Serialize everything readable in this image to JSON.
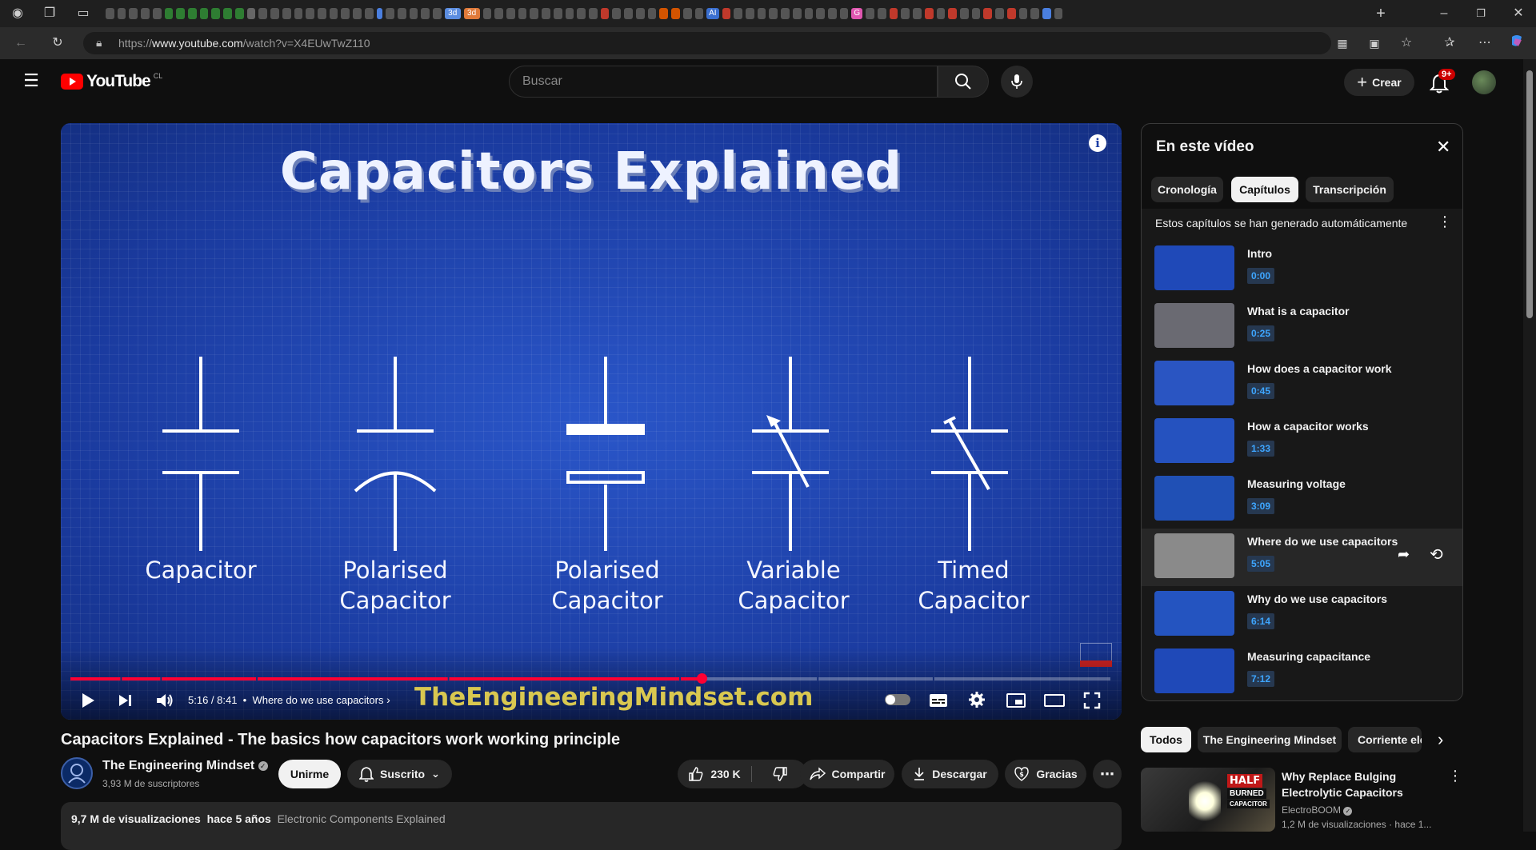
{
  "browser": {
    "url_prefix": "https://",
    "url_host": "www.youtube.com",
    "url_path": "/watch?v=X4EUwTwZ110",
    "tab_badges": [
      "3d",
      "3d",
      "AI",
      "G"
    ]
  },
  "header": {
    "logo_text": "YouTube",
    "country": "CL",
    "search_placeholder": "Buscar",
    "create_label": "Crear",
    "notif_count": "9+"
  },
  "video": {
    "frame_title": "Capacitors Explained",
    "symbols": [
      {
        "line1": "Capacitor",
        "line2": ""
      },
      {
        "line1": "Polarised",
        "line2": "Capacitor"
      },
      {
        "line1": "Polarised",
        "line2": "Capacitor"
      },
      {
        "line1": "Variable",
        "line2": "Capacitor"
      },
      {
        "line1": "Timed",
        "line2": "Capacitor"
      }
    ],
    "watermark": "TheEngineeringMindset.com",
    "time": "5:16 / 8:41",
    "chapter": "Where do we use capacitors",
    "progress": 0.607
  },
  "panel": {
    "title": "En este vídeo",
    "tabs": [
      "Cronología",
      "Capítulos",
      "Transcripción"
    ],
    "active_tab": "Capítulos",
    "note": "Estos capítulos se han generado automáticamente",
    "chapters": [
      {
        "title": "Intro",
        "time": "0:00"
      },
      {
        "title": "What is a capacitor",
        "time": "0:25"
      },
      {
        "title": "How does a capacitor work",
        "time": "0:45"
      },
      {
        "title": "How a capacitor works",
        "time": "1:33"
      },
      {
        "title": "Measuring voltage",
        "time": "3:09"
      },
      {
        "title": "Where do we use capacitors",
        "time": "5:05"
      },
      {
        "title": "Why do we use capacitors",
        "time": "6:14"
      },
      {
        "title": "Measuring capacitance",
        "time": "7:12"
      }
    ]
  },
  "info": {
    "title": "Capacitors Explained - The basics how capacitors work working principle",
    "channel": "The Engineering Mindset",
    "subscribers": "3,93 M de suscriptores",
    "join_label": "Unirme",
    "subscribed_label": "Suscrito",
    "likes": "230 K",
    "share_label": "Compartir",
    "download_label": "Descargar",
    "thanks_label": "Gracias",
    "views": "9,7 M de visualizaciones",
    "age": "hace 5 años",
    "playlist": "Electronic Components Explained"
  },
  "recommendations": {
    "chips": [
      "Todos",
      "The Engineering Mindset",
      "Corriente elé"
    ],
    "first": {
      "title_line1": "Why Replace Bulging",
      "title_line2": "Electrolytic Capacitors",
      "channel": "ElectroBOOM",
      "meta": "1,2 M de visualizaciones · hace 1...",
      "thumb_text1": "HALF",
      "thumb_text2": "BURNED",
      "thumb_text3": "CAPACITOR"
    }
  }
}
